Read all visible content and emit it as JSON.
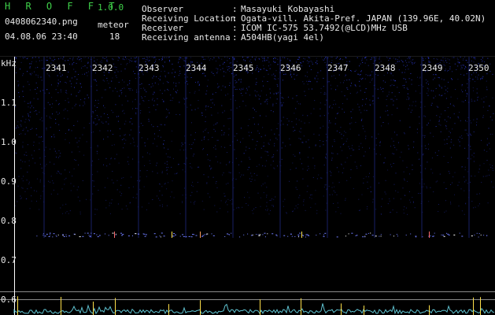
{
  "header": {
    "app_name": "H R O F F T",
    "version": "1.0.0",
    "filename": "0408062340.png",
    "datetime": "04.08.06 23:40",
    "meteor_label": "meteor",
    "meteor_count": "18",
    "info": [
      {
        "label": "Observer",
        "sep": ":",
        "value": "Masayuki Kobayashi"
      },
      {
        "label": "Receiving Location",
        "sep": ":",
        "value": "Ogata-vill. Akita-Pref. JAPAN (139.96E, 40.02N)"
      },
      {
        "label": "Receiver",
        "sep": ":",
        "value": "ICOM IC-575 53.7492(@LCD)MHz USB"
      },
      {
        "label": "Receiving antenna",
        "sep": ":",
        "value": "A504HB(yagi 4el)"
      }
    ]
  },
  "spectrogram": {
    "y_unit": "kHz",
    "y_ticks": [
      "1.1",
      "1.0",
      "0.9",
      "0.8",
      "0.7",
      "0.6"
    ],
    "minute_labels": [
      "2341",
      "2342",
      "2343",
      "2344",
      "2345",
      "2346",
      "2347",
      "2348",
      "2349",
      "2350"
    ],
    "colors": {
      "noise": "#2d3bd6",
      "echo": "#ffe04a",
      "baseline": "#6fe2f2",
      "axis": "#ffffff"
    }
  }
}
